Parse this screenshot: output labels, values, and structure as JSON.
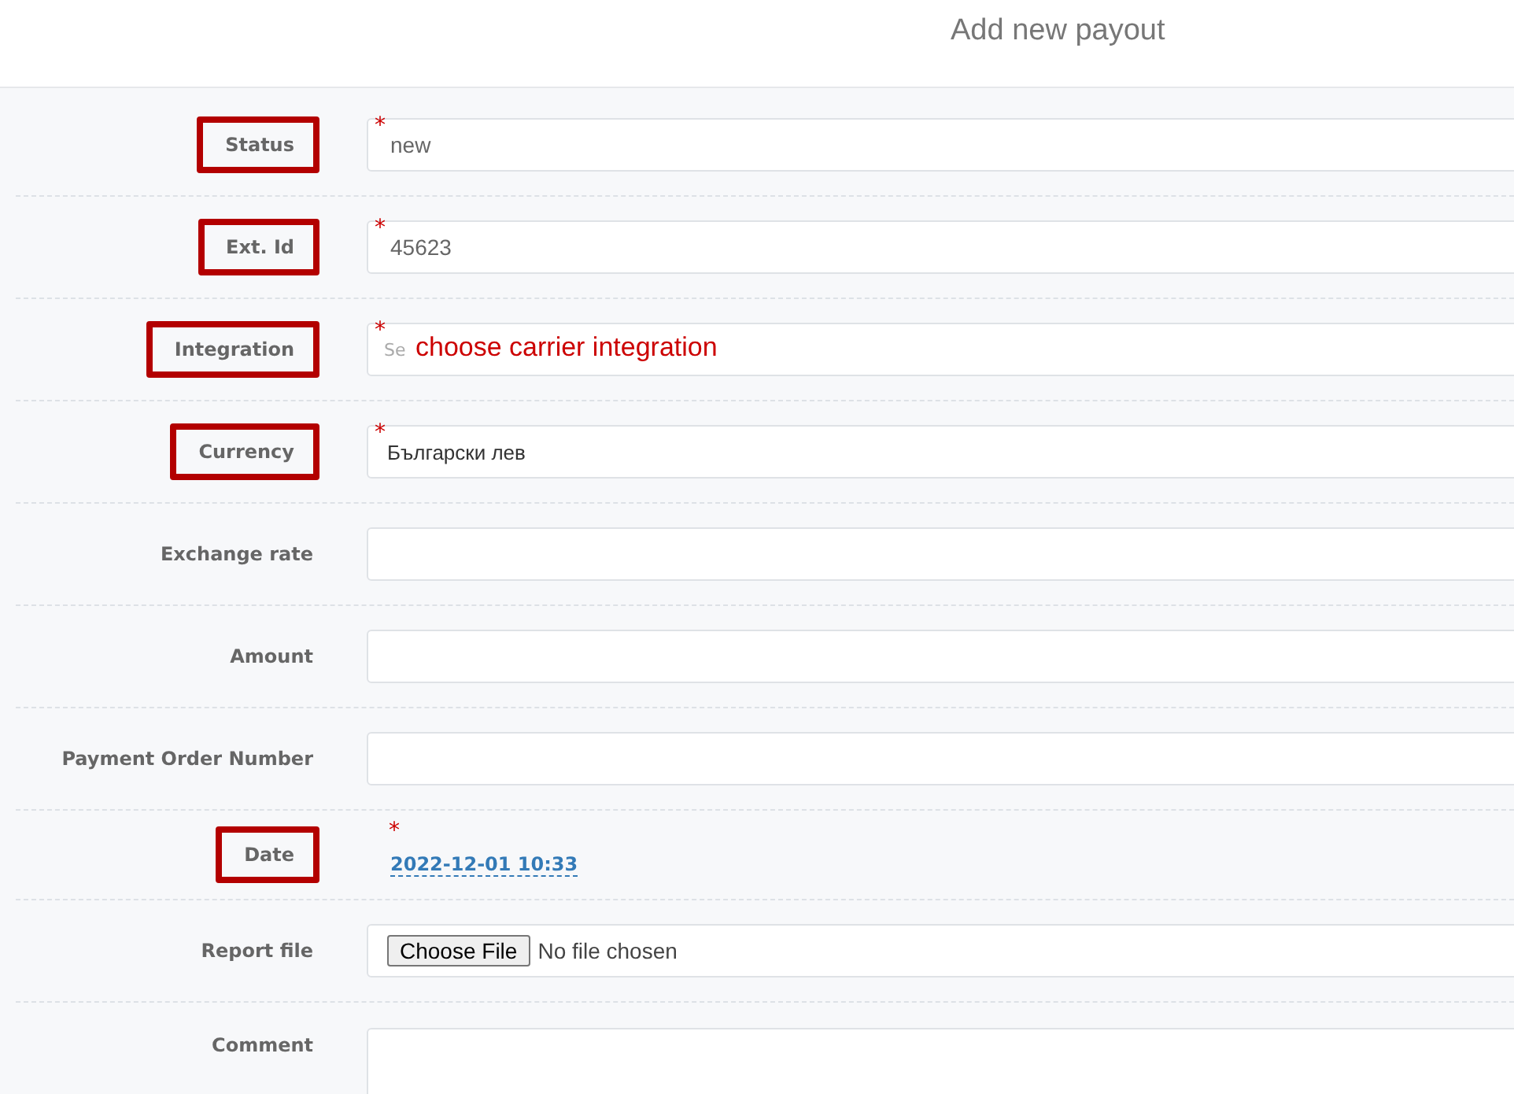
{
  "header": {
    "title": "Add new payout"
  },
  "fields": [
    {
      "label": "Status",
      "kind": "text",
      "value": "new",
      "required_mark": "*",
      "highlighted": true
    },
    {
      "label": "Ext. Id",
      "kind": "text",
      "value": "45623",
      "required_mark": "*",
      "highlighted": true
    },
    {
      "label": "Integration",
      "kind": "select",
      "placeholder": "Se",
      "required_mark": "*",
      "highlighted": true,
      "annotation": "choose carrier integration"
    },
    {
      "label": "Currency",
      "kind": "select",
      "value": "Български лев",
      "required_mark": "*",
      "highlighted": true
    },
    {
      "label": "Exchange rate",
      "kind": "text",
      "highlighted": false
    },
    {
      "label": "Amount",
      "kind": "text",
      "highlighted": false
    },
    {
      "label": "Payment Order Number",
      "kind": "text",
      "highlighted": false
    },
    {
      "label": "Date",
      "kind": "date",
      "value": "2022-12-01 10:33",
      "required_mark": "*",
      "highlighted": true
    },
    {
      "label": "Report file",
      "kind": "file",
      "button": "Choose File",
      "status": "No file chosen",
      "highlighted": false
    },
    {
      "label": "Comment",
      "kind": "textarea",
      "highlighted": false
    }
  ]
}
